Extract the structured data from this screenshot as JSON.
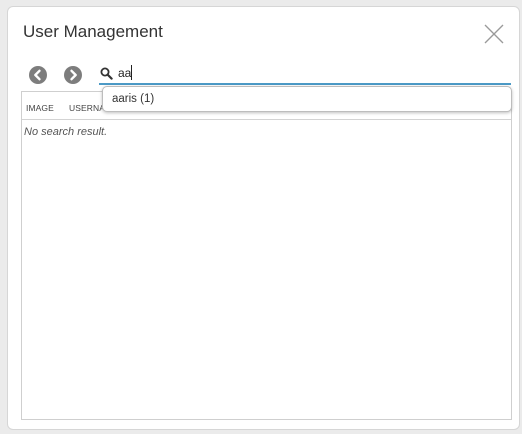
{
  "dialog": {
    "title": "User Management"
  },
  "icons": {
    "close": "close-icon",
    "back": "arrow-left-circle-icon",
    "forward": "arrow-right-circle-icon",
    "search": "search-icon"
  },
  "search": {
    "value": "aa",
    "placeholder": ""
  },
  "suggestions": [
    {
      "label": "aaris (1)"
    }
  ],
  "table": {
    "columns": [
      "IMAGE",
      "USERNAME"
    ],
    "empty_message": "No search result."
  },
  "colors": {
    "accent": "#4c9ac6",
    "nav_icon": "#7d7d7d"
  }
}
